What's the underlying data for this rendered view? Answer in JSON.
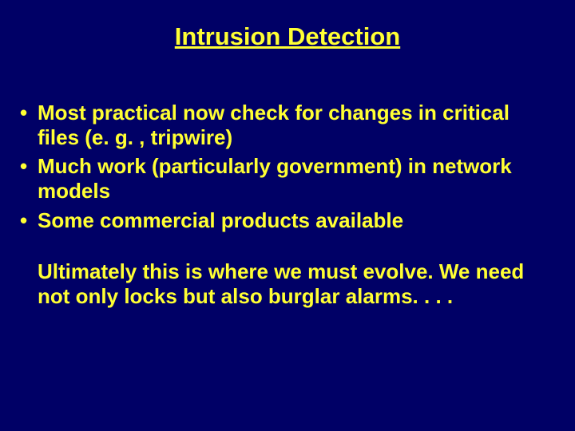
{
  "slide": {
    "title": "Intrusion Detection",
    "bullets": [
      "Most practical now check for changes in critical files (e. g. ,  tripwire)",
      "Much work (particularly government) in network models",
      "Some commercial products available"
    ],
    "conclusion": "Ultimately this is where we must evolve.  We need not only locks but also burglar alarms. . . ."
  }
}
